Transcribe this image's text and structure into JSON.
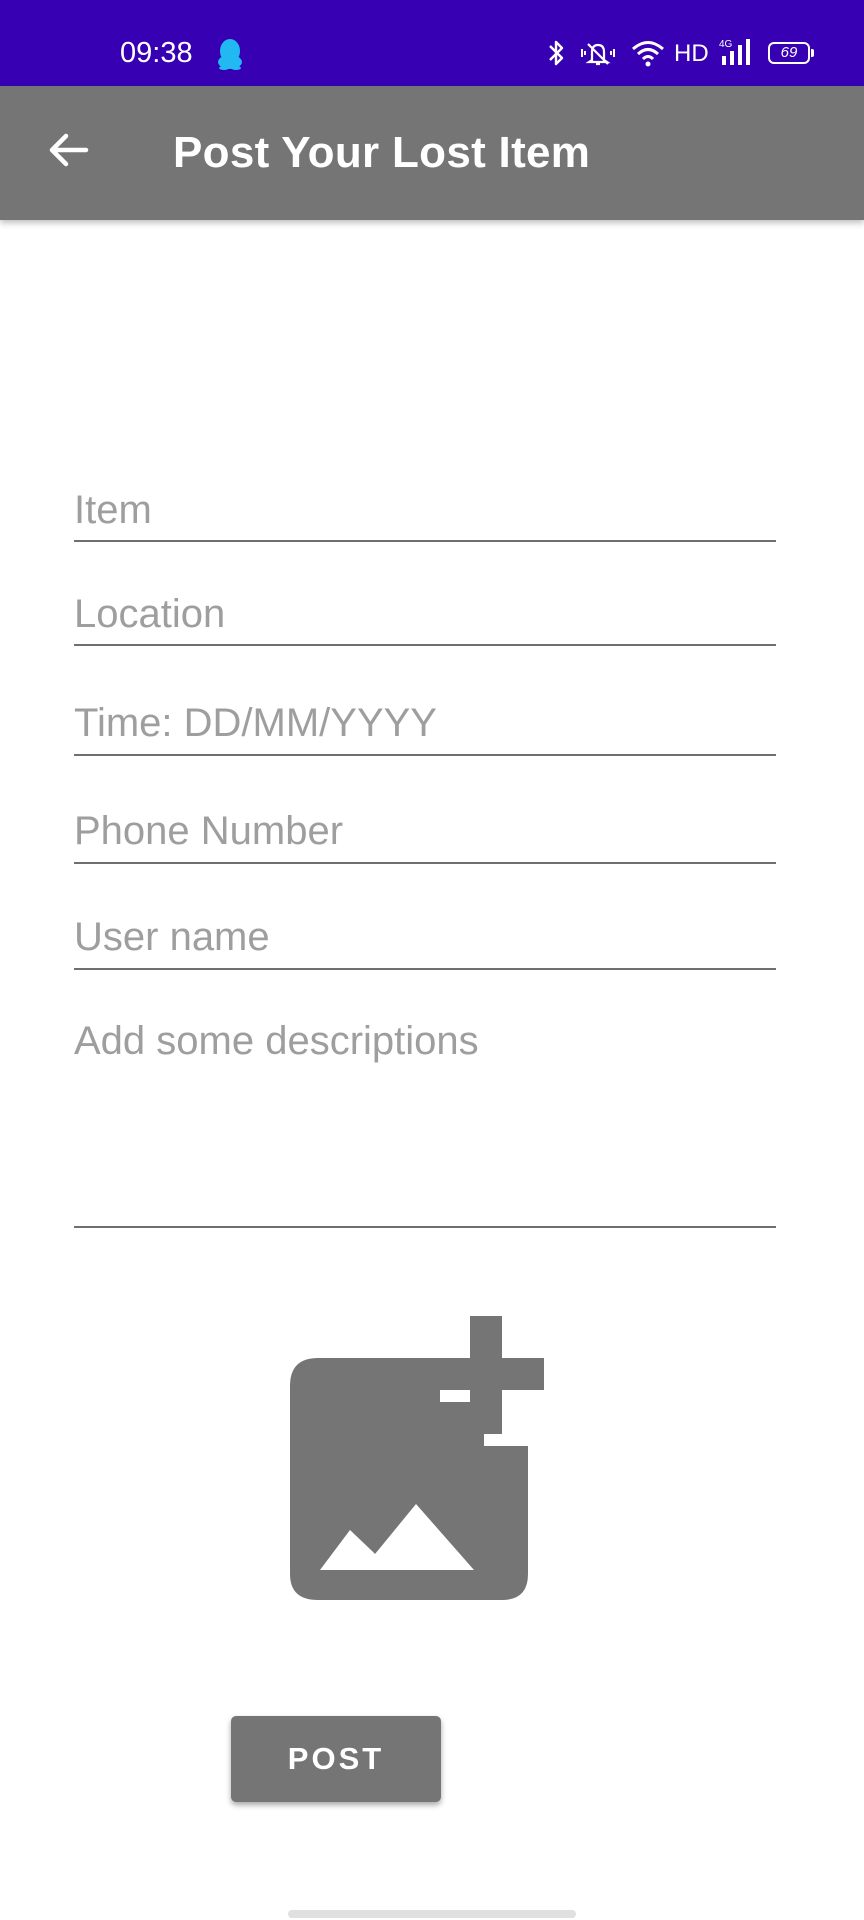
{
  "status_bar": {
    "time": "09:38",
    "network_label": "HD",
    "battery_level": "69",
    "background_color": "#3700b3",
    "icons": [
      "qq-icon",
      "bluetooth-icon",
      "mute-icon",
      "wifi-icon",
      "signal-4g-icon",
      "battery-icon"
    ]
  },
  "app_bar": {
    "title": "Post Your Lost Item",
    "back_icon": "arrow-back-icon",
    "background_color": "#757575"
  },
  "form": {
    "item": {
      "placeholder": "Item",
      "value": ""
    },
    "location": {
      "placeholder": "Location",
      "value": ""
    },
    "time": {
      "placeholder": "Time: DD/MM/YYYY",
      "value": ""
    },
    "phone": {
      "placeholder": "Phone Number",
      "value": ""
    },
    "user_name": {
      "placeholder": "User name",
      "value": ""
    },
    "description": {
      "placeholder": "Add some descriptions",
      "value": ""
    }
  },
  "add_image": {
    "icon": "add-photo-icon"
  },
  "post_button": {
    "label": "POST"
  }
}
